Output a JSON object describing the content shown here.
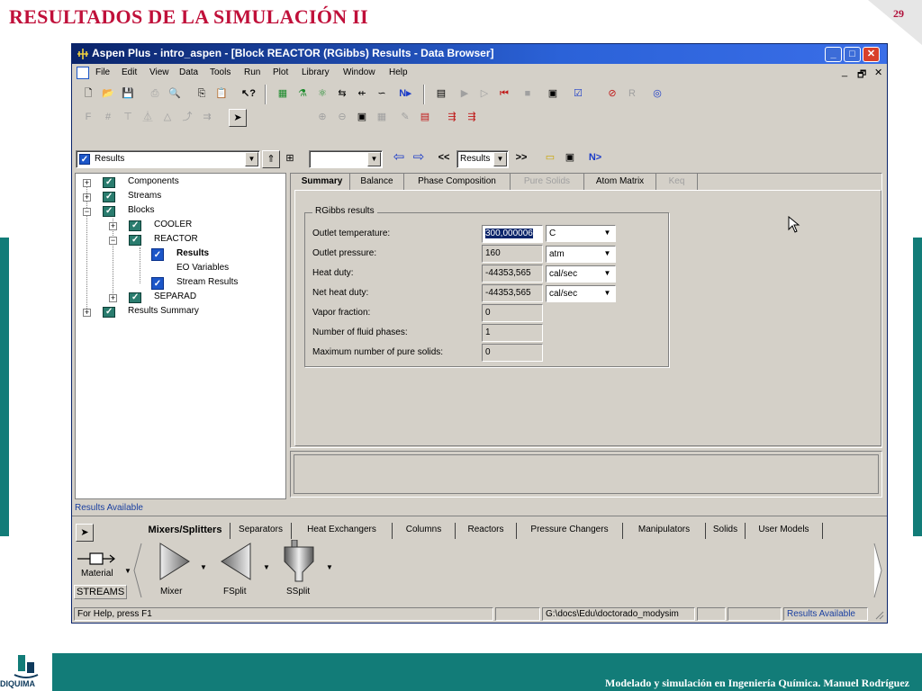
{
  "slide": {
    "title": "RESULTADOS DE LA SIMULACIÓN II",
    "page_number": "29",
    "footer": "Modelado y simulación en Ingeniería Química.  Manuel Rodríguez",
    "logo_text": "DIQUIMA",
    "accent_color": "#127c78",
    "title_color": "#c0103a"
  },
  "window": {
    "title": "Aspen Plus - intro_aspen - [Block REACTOR (RGibbs) Results - Data Browser]",
    "controls": {
      "minimize": "_",
      "maximize": "□",
      "close": "✕"
    }
  },
  "menu": [
    "File",
    "Edit",
    "View",
    "Data",
    "Tools",
    "Run",
    "Plot",
    "Library",
    "Window",
    "Help"
  ],
  "mdi_controls": [
    "_",
    "🗗",
    "✕"
  ],
  "nav": {
    "folder_combo": "Results",
    "results_combo": "Results",
    "prev": "<<",
    "next": ">>",
    "n_button": "N>"
  },
  "tree": {
    "items": [
      {
        "label": "Components"
      },
      {
        "label": "Streams"
      },
      {
        "label": "Blocks"
      },
      {
        "label": "COOLER"
      },
      {
        "label": "REACTOR"
      },
      {
        "label": "Results"
      },
      {
        "label": "EO Variables"
      },
      {
        "label": "Stream Results"
      },
      {
        "label": "SEPARAD"
      },
      {
        "label": "Results Summary"
      }
    ]
  },
  "tabs": [
    {
      "label": "Summary",
      "state": "active"
    },
    {
      "label": "Balance",
      "state": "enabled"
    },
    {
      "label": "Phase Composition",
      "state": "enabled"
    },
    {
      "label": "Pure Solids",
      "state": "disabled"
    },
    {
      "label": "Atom Matrix",
      "state": "enabled"
    },
    {
      "label": "Keq",
      "state": "disabled"
    }
  ],
  "group": {
    "title": "RGibbs results",
    "fields": [
      {
        "label": "Outlet temperature:",
        "value": "300,000006",
        "unit": "C"
      },
      {
        "label": "Outlet pressure:",
        "value": "160",
        "unit": "atm"
      },
      {
        "label": "Heat duty:",
        "value": "-44353,565",
        "unit": "cal/sec"
      },
      {
        "label": "Net heat duty:",
        "value": "-44353,565",
        "unit": "cal/sec"
      },
      {
        "label": "Vapor fraction:",
        "value": "0"
      },
      {
        "label": "Number of fluid phases:",
        "value": "1"
      },
      {
        "label": "Maximum number of pure solids:",
        "value": "0"
      }
    ]
  },
  "status_message": "Results Available",
  "palette": {
    "tabs": [
      "Mixers/Splitters",
      "Separators",
      "Heat Exchangers",
      "Columns",
      "Reactors",
      "Pressure Changers",
      "Manipulators",
      "Solids",
      "User Models"
    ],
    "material_label": "Material",
    "streams_label": "STREAMS",
    "models": [
      "Mixer",
      "FSplit",
      "SSplit"
    ]
  },
  "statusbar": {
    "help": "For Help, press F1",
    "path": "G:\\docs\\Edu\\doctorado_modysim",
    "status": "Results Available"
  }
}
